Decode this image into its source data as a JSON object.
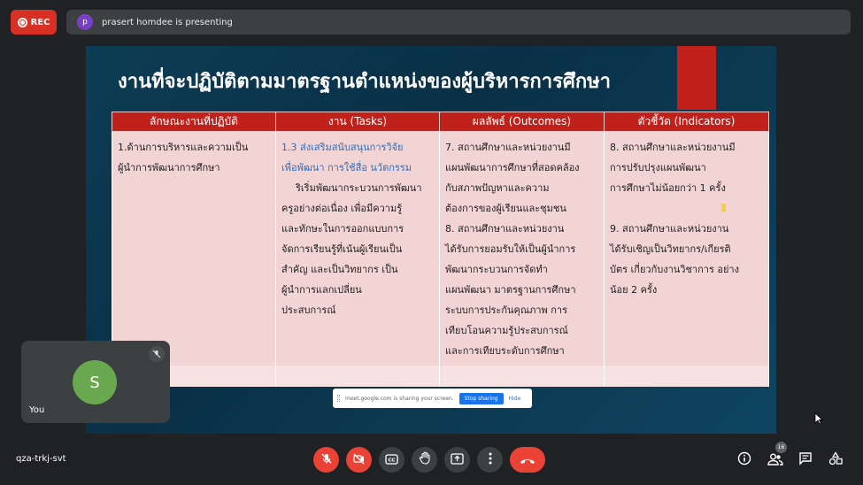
{
  "top_bar": {
    "rec_label": "REC",
    "presenter_initial": "p",
    "presenting_text": "prasert homdee is presenting"
  },
  "slide": {
    "title": "งานที่จะปฏิบัติตามมาตรฐานตำแหน่งของผู้บริหารการศึกษา",
    "table": {
      "headers": [
        "ลักษณะงานที่ปฏิบัติ",
        "งาน (Tasks)",
        "ผลลัพธ์ (Outcomes)",
        "ตัวชี้วัด (Indicators)"
      ],
      "col1": [
        "1.ด้านการบริหารและความเป็น",
        "ผู้นำการพัฒนาการศึกษา"
      ],
      "col2_blue": [
        "1.3 ส่งเสริมสนับสนุนการวิจัย",
        "เพื่อพัฒนา การใช้สื่อ นวัตกรรม"
      ],
      "col2": [
        "ริเริ่มพัฒนากระบวนการพัฒนา",
        "ครูอย่างต่อเนื่อง เพื่อมีความรู้",
        "และทักษะในการออกแบบการ",
        "จัดการเรียนรู้ที่เน้นผู้เรียนเป็น",
        "สำคัญ และเป็นวิทยากร เป็น",
        "ผู้นำการแลกเปลี่ยน",
        "ประสบการณ์"
      ],
      "col3": [
        "7. สถานศึกษาและหน่วยงานมี",
        "แผนพัฒนาการศึกษาที่สอดคล้อง",
        "กับสภาพปัญหาและความ",
        "ต้องการของผู้เรียนและชุมชน",
        "8. สถานศึกษาและหน่วยงาน",
        "ได้รับการยอมรับให้เป็นผู้นำการ",
        "พัฒนากระบวนการจัดทำ",
        "แผนพัฒนา มาตรฐานการศึกษา",
        "ระบบการประกันคุณภาพ การ",
        "เทียบโอนความรู้ประสบการณ์",
        "และการเทียบระดับการศึกษา"
      ],
      "col4_a": [
        "8. สถานศึกษาและหน่วยงานมี",
        "การปรับปรุงแผนพัฒนา",
        "การศึกษาไม่น้อยกว่า 1 ครั้ง"
      ],
      "col4_b": [
        "9. สถานศึกษาและหน่วยงาน",
        "ได้รับเชิญเป็นวิทยากร/เกียรติ",
        "บัตร เกี่ยวกับงานวิชาการ อย่าง",
        "น้อย 2 ครั้ง"
      ]
    }
  },
  "share_bar": {
    "message": "meet.google.com is sharing your screen.",
    "stop_label": "Stop sharing",
    "hide_label": "Hide"
  },
  "self_tile": {
    "initial": "S",
    "name": "You"
  },
  "bottom_bar": {
    "meeting_code": "qza-trkj-svt",
    "participants_count": "16"
  },
  "colors": {
    "accent_red": "#ea4335",
    "slide_red": "#c0211b",
    "avatar_green": "#6aa84f",
    "presenter_purple": "#7b3fc4"
  }
}
